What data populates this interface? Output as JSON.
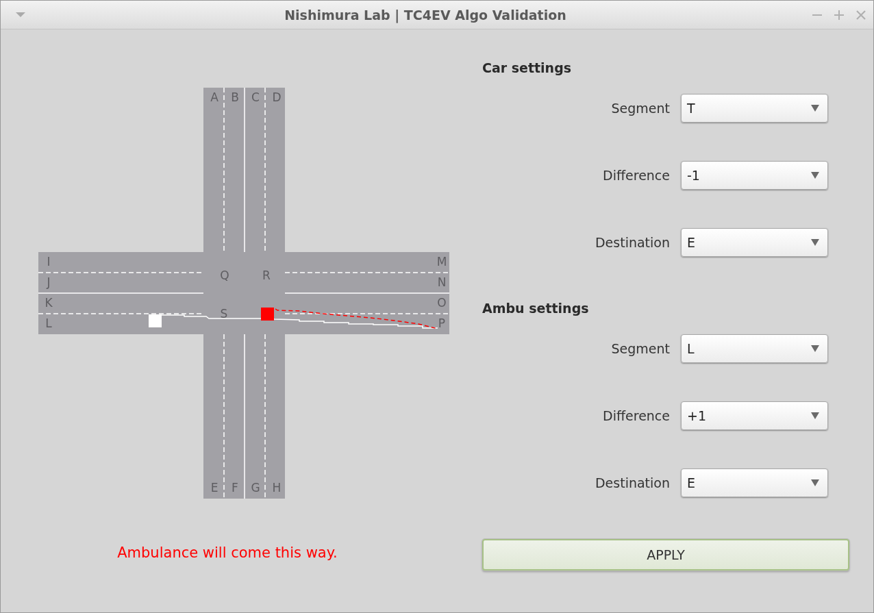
{
  "window": {
    "title": "Nishimura Lab | TC4EV Algo Validation"
  },
  "map": {
    "lane_labels_top": [
      "A",
      "B",
      "C",
      "D"
    ],
    "lane_labels_bottom": [
      "E",
      "F",
      "G",
      "H"
    ],
    "lane_labels_left": [
      "I",
      "J",
      "K",
      "L"
    ],
    "lane_labels_right": [
      "M",
      "N",
      "O",
      "P"
    ],
    "junction_labels": [
      "Q",
      "R",
      "S"
    ]
  },
  "message": "Ambulance will come this way.",
  "sections": [
    {
      "title": "Car settings",
      "fields": [
        {
          "label": "Segment",
          "value": "T"
        },
        {
          "label": "Difference",
          "value": "-1"
        },
        {
          "label": "Destination",
          "value": "E"
        }
      ]
    },
    {
      "title": "Ambu settings",
      "fields": [
        {
          "label": "Segment",
          "value": "L"
        },
        {
          "label": "Difference",
          "value": "+1"
        },
        {
          "label": "Destination",
          "value": "E"
        }
      ]
    }
  ],
  "apply_button": "APPLY"
}
